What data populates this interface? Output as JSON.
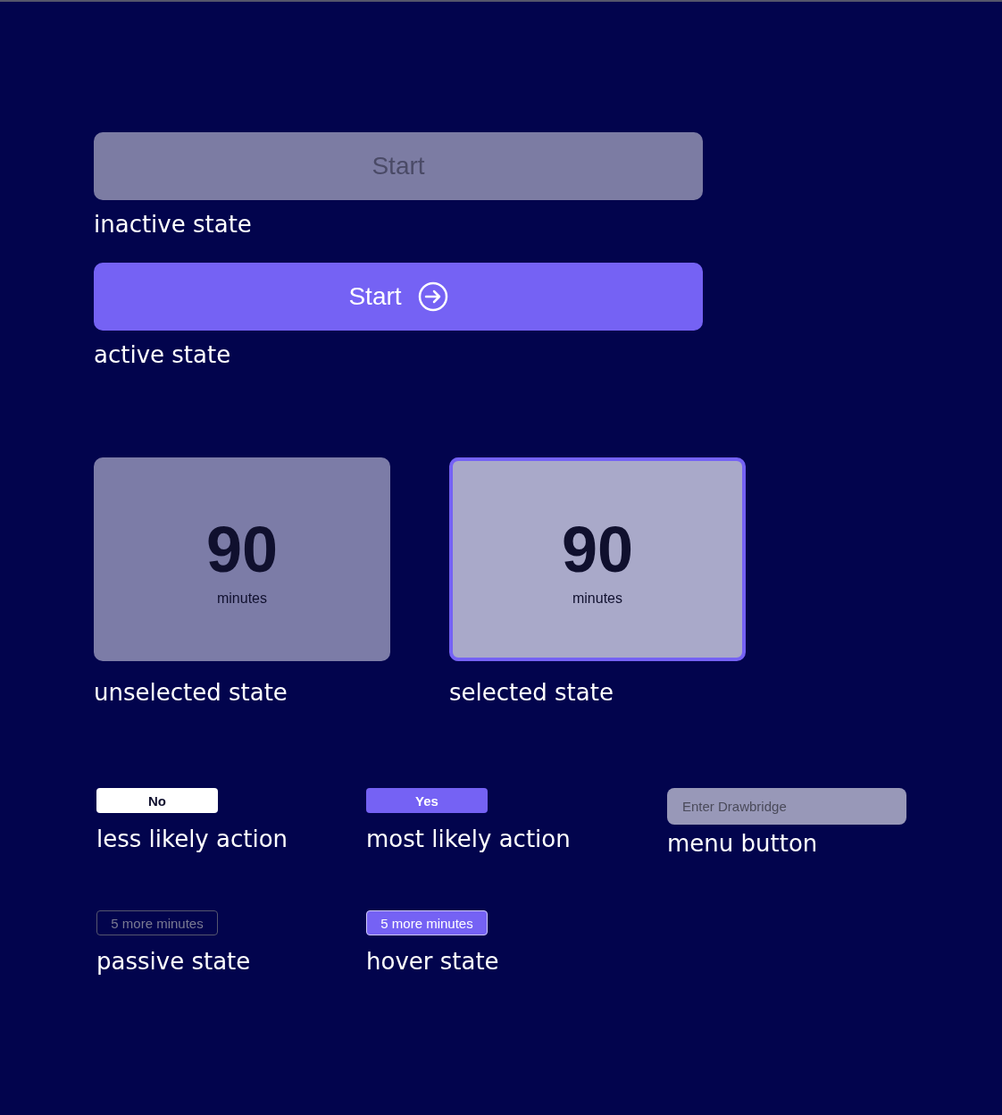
{
  "start_buttons": [
    {
      "label": "Start",
      "disabled": true,
      "caption": "inactive state"
    },
    {
      "label": "Start",
      "disabled": false,
      "caption": "active state"
    }
  ],
  "duration_cards": [
    {
      "value": "90",
      "unit": "minutes",
      "selected": false,
      "caption": "unselected state"
    },
    {
      "value": "90",
      "unit": "minutes",
      "selected": true,
      "caption": "selected state"
    }
  ],
  "action_rows": [
    [
      {
        "kind": "secondary",
        "label": "No",
        "caption": "less likely action"
      },
      {
        "kind": "primary",
        "label": "Yes",
        "caption": "most likely action"
      },
      {
        "kind": "menu",
        "label": "Enter Drawbridge",
        "caption": "menu button"
      }
    ],
    [
      {
        "kind": "passive",
        "label": "5 more minutes",
        "caption": "passive state"
      },
      {
        "kind": "hover",
        "label": "5 more minutes",
        "caption": "hover state"
      }
    ]
  ]
}
